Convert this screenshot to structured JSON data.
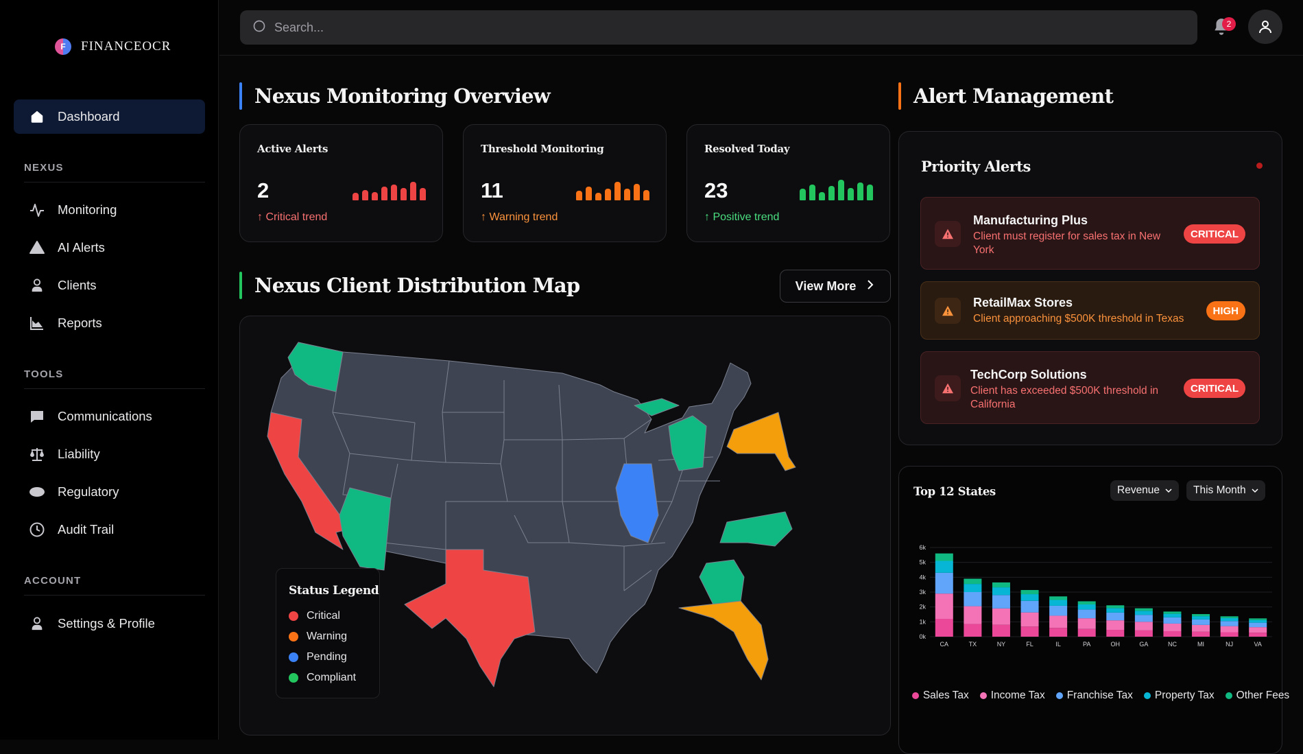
{
  "brand": {
    "name": "FINANCEOCR",
    "logo_letter": "F"
  },
  "sidebar": {
    "main": [
      {
        "label": "Dashboard",
        "icon": "home-icon",
        "active": true
      }
    ],
    "sections": [
      {
        "label": "NEXUS",
        "items": [
          {
            "label": "Monitoring",
            "icon": "activity-icon"
          },
          {
            "label": "AI Alerts",
            "icon": "triangle-icon"
          },
          {
            "label": "Clients",
            "icon": "user-icon"
          },
          {
            "label": "Reports",
            "icon": "chart-icon"
          }
        ]
      },
      {
        "label": "TOOLS",
        "items": [
          {
            "label": "Communications",
            "icon": "message-icon"
          },
          {
            "label": "Liability",
            "icon": "scale-icon"
          },
          {
            "label": "Regulatory",
            "icon": "ellipse-icon"
          },
          {
            "label": "Audit Trail",
            "icon": "clock-icon"
          }
        ]
      },
      {
        "label": "ACCOUNT",
        "items": [
          {
            "label": "Settings & Profile",
            "icon": "user-icon"
          }
        ]
      }
    ]
  },
  "header": {
    "search_placeholder": "Search...",
    "notification_count": "2"
  },
  "overview": {
    "title": "Nexus Monitoring Overview",
    "accent": "#3b82f6",
    "cards": [
      {
        "title": "Active Alerts",
        "value": "2",
        "trend": "Critical trend",
        "color": "#ef4444",
        "spark": [
          0.35,
          0.5,
          0.4,
          0.65,
          0.75,
          0.6,
          0.9,
          0.6
        ]
      },
      {
        "title": "Threshold Monitoring",
        "value": "11",
        "trend": "Warning trend",
        "color": "#f97316",
        "spark": [
          0.45,
          0.65,
          0.35,
          0.55,
          0.9,
          0.55,
          0.8,
          0.5
        ]
      },
      {
        "title": "Resolved Today",
        "value": "23",
        "trend": "Positive trend",
        "color": "#22c55e",
        "spark": [
          0.55,
          0.75,
          0.4,
          0.7,
          1.0,
          0.6,
          0.85,
          0.75
        ]
      }
    ]
  },
  "map": {
    "title": "Nexus Client Distribution Map",
    "accent": "#22c55e",
    "view_more": "View More",
    "legend_title": "Status Legend",
    "legend": [
      {
        "label": "Critical",
        "color": "#ef4444"
      },
      {
        "label": "Warning",
        "color": "#f97316"
      },
      {
        "label": "Pending",
        "color": "#3b82f6"
      },
      {
        "label": "Compliant",
        "color": "#22c55e"
      }
    ],
    "states": {
      "critical": [
        "California",
        "Texas"
      ],
      "warning": [
        "New York",
        "Florida"
      ],
      "pending": [
        "Illinois"
      ],
      "compliant": [
        "Washington",
        "Arizona",
        "Michigan",
        "Georgia",
        "North Carolina"
      ]
    }
  },
  "alerts": {
    "title": "Alert Management",
    "accent": "#f97316",
    "panel_title": "Priority Alerts",
    "items": [
      {
        "name": "Manufacturing Plus",
        "desc1": "Client must register for sales tax in New",
        "desc2": "York",
        "badge": "CRITICAL",
        "level": "critical"
      },
      {
        "name": "RetailMax Stores",
        "desc1": "Client approaching $500K threshold in Texas",
        "desc2": "",
        "badge": "HIGH",
        "level": "high"
      },
      {
        "name": "TechCorp Solutions",
        "desc1": "Client has exceeded $500K threshold in",
        "desc2": "California",
        "badge": "CRITICAL",
        "level": "critical"
      }
    ]
  },
  "top_states": {
    "title": "Top 12 States",
    "metric_select": "Revenue",
    "period_select": "This Month"
  },
  "chart_data": {
    "type": "bar",
    "stacked": true,
    "categories": [
      "CA",
      "TX",
      "NY",
      "FL",
      "IL",
      "PA",
      "OH",
      "GA",
      "NC",
      "MI",
      "NJ",
      "VA"
    ],
    "series": [
      {
        "name": "Sales Tax",
        "color": "#ec4899",
        "values": [
          1200,
          850,
          800,
          680,
          590,
          520,
          460,
          420,
          370,
          330,
          300,
          270
        ]
      },
      {
        "name": "Income Tax",
        "color": "#f472b6",
        "values": [
          1700,
          1200,
          1100,
          950,
          820,
          720,
          640,
          580,
          510,
          460,
          410,
          370
        ]
      },
      {
        "name": "Franchise Tax",
        "color": "#60a5fa",
        "values": [
          1400,
          950,
          900,
          780,
          670,
          590,
          520,
          470,
          420,
          370,
          340,
          300
        ]
      },
      {
        "name": "Property Tax",
        "color": "#06b6d4",
        "values": [
          800,
          550,
          520,
          450,
          390,
          340,
          300,
          270,
          240,
          220,
          200,
          180
        ]
      },
      {
        "name": "Other Fees",
        "color": "#10b981",
        "values": [
          500,
          350,
          330,
          280,
          240,
          210,
          190,
          170,
          150,
          140,
          120,
          110
        ]
      }
    ],
    "yticks": [
      "0k",
      "1k",
      "2k",
      "3k",
      "4k",
      "5k",
      "6k"
    ],
    "ylim": [
      0,
      6000
    ]
  }
}
